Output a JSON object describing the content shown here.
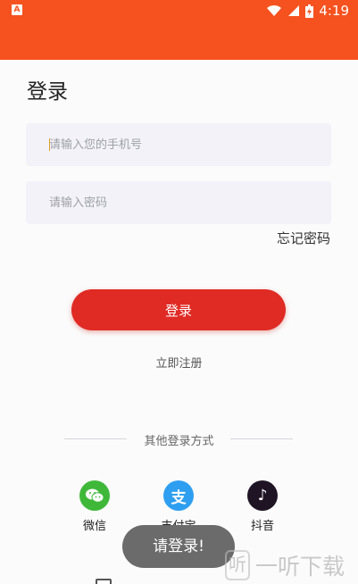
{
  "status_bar": {
    "app_icon_letter": "A",
    "time": "4:19",
    "wifi_icon": "wifi-icon",
    "signal_icon": "signal-icon",
    "battery_icon": "battery-charging-icon"
  },
  "page": {
    "title": "登录",
    "phone_placeholder": "请输入您的手机号",
    "password_placeholder": "请输入密码",
    "forgot_password": "忘记密码",
    "login_button": "登录",
    "register_link": "立即注册",
    "other_login_title": "其他登录方式"
  },
  "social": [
    {
      "label": "微信",
      "icon": "wechat-icon",
      "color": "#3fb83a",
      "glyph": "◕"
    },
    {
      "label": "支付宝",
      "icon": "alipay-icon",
      "color": "#2e9ff0",
      "glyph": "支"
    },
    {
      "label": "抖音",
      "icon": "tiktok-icon",
      "color": "#1f1423",
      "glyph": "♪"
    }
  ],
  "toast": "请登录!",
  "watermark": {
    "glyph": "听",
    "text": "一听下载"
  },
  "colors": {
    "accent": "#f5521f",
    "login_button": "#e02a24",
    "input_bg": "#f2f2f8"
  }
}
